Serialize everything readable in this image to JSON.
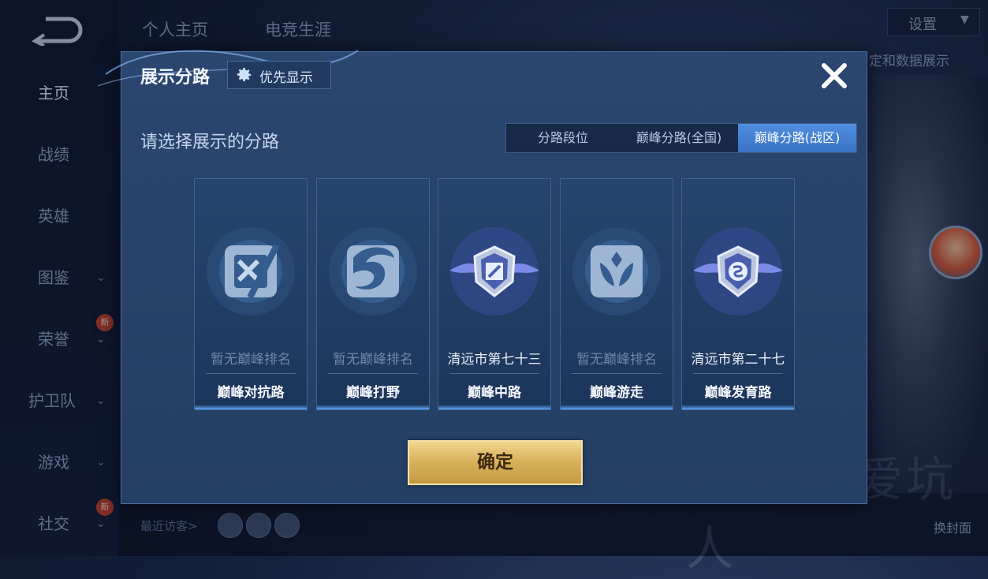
{
  "sidebar": {
    "items": [
      {
        "label": "主页",
        "active": true
      },
      {
        "label": "战绩"
      },
      {
        "label": "英雄"
      },
      {
        "label": "图鉴",
        "chevron": true
      },
      {
        "label": "荣誉",
        "chevron": true,
        "badge": "新"
      },
      {
        "label": "护卫队",
        "chevron": true
      },
      {
        "label": "游戏",
        "chevron": true
      },
      {
        "label": "社交",
        "chevron": true,
        "badge": "新"
      }
    ]
  },
  "header": {
    "tabs": [
      "个人主页",
      "电竞生涯"
    ],
    "settings_label": "设置",
    "right_label": "定和数据展示"
  },
  "background": {
    "visitors_label": "最近访客>",
    "cover_label": "换封面",
    "big_text": "又菜 又爱坑人"
  },
  "modal": {
    "title": "展示分路",
    "priority_label": "优先显示",
    "subtitle": "请选择展示的分路",
    "tabs": [
      {
        "label": "分路段位",
        "active": false
      },
      {
        "label": "巅峰分路(全国)",
        "active": false
      },
      {
        "label": "巅峰分路(战区)",
        "active": true
      }
    ],
    "cards": [
      {
        "rank": "暂无巅峰排名",
        "name": "巅峰对抗路",
        "icon": "top-lane-icon",
        "has_rank": false
      },
      {
        "rank": "暂无巅峰排名",
        "name": "巅峰打野",
        "icon": "jungle-icon",
        "has_rank": false
      },
      {
        "rank": "清远市第七十三",
        "name": "巅峰中路",
        "icon": "mid-lane-badge-icon",
        "has_rank": true
      },
      {
        "rank": "暂无巅峰排名",
        "name": "巅峰游走",
        "icon": "roam-icon",
        "has_rank": false
      },
      {
        "rank": "清远市第二十七",
        "name": "巅峰发育路",
        "icon": "farm-lane-badge-icon",
        "has_rank": true
      }
    ],
    "confirm_label": "确定"
  },
  "colors": {
    "accent_blue": "#3b73c4",
    "gold": "#d8b05a",
    "modal_bg": "#2b466f"
  }
}
